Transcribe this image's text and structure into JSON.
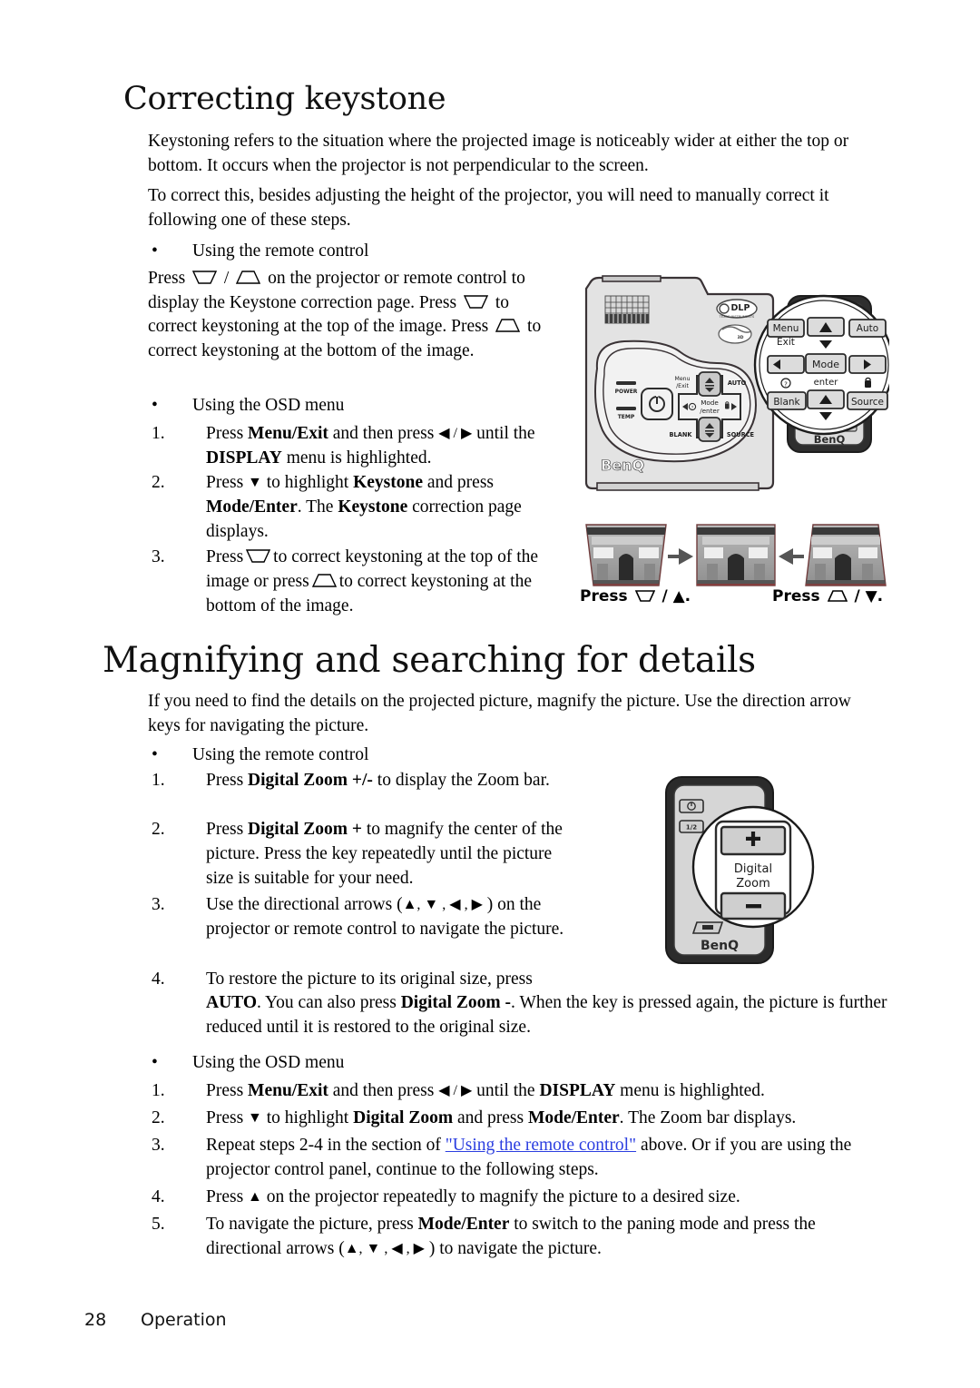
{
  "document": {
    "page_number": "28",
    "footer_section": "Operation"
  },
  "section1": {
    "heading": "Correcting keystone",
    "intro1": "Keystoning refers to the situation where the projected image is noticeably wider at either the top or bottom. It occurs when the projector is not perpendicular to the screen.",
    "intro2": "To correct this, besides adjusting the height of the projector, you will need to manually correct it following one of these steps.",
    "bullet_remote": "Using the remote control",
    "remote_para_a": "Press",
    "remote_para_b": "/",
    "remote_para_c": "on the projector or remote control to display the Keystone correction page. Press",
    "remote_para_d": "to correct keystoning at the top of the image. Press",
    "remote_para_e": "to correct keystoning at the bottom of the image.",
    "bullet_osd": "Using the OSD menu",
    "osd_items": [
      {
        "num": "1.",
        "a": "Press ",
        "bold1": "Menu/Exit",
        "b": " and then press ",
        "arrows": "◀ / ▶",
        "c": " until the ",
        "bold2": "DISPLAY",
        "d": " menu is highlighted."
      },
      {
        "num": "2.",
        "a": "Press ",
        "arrows": "▼",
        "b": " to highlight ",
        "bold1": "Keystone",
        "c": " and press ",
        "bold2": "Mode/Enter",
        "d": ". The ",
        "bold3": "Keystone",
        "e": " correction page displays."
      },
      {
        "num": "3.",
        "a": "Press",
        "b": "to correct keystoning at the top of the image or press",
        "c": "to correct keystoning at the bottom of the image."
      }
    ]
  },
  "section2": {
    "heading": "Magnifying and searching for details",
    "intro": "If you need to find the details on the projected picture, magnify the picture. Use the direction arrow keys for navigating the picture.",
    "bullet_remote": "Using the remote control",
    "remote_items": [
      {
        "num": "1.",
        "a": "Press ",
        "bold1": "Digital Zoom +/-",
        "b": " to display the Zoom bar."
      },
      {
        "num": "2.",
        "a": "Press ",
        "bold1": "Digital Zoom +",
        "b": " to magnify the center of the picture. Press the key repeatedly until the picture size is suitable for your need."
      },
      {
        "num": "3.",
        "a": "Use the directional arrows (",
        "arrows": "▲, ▼ , ◀ , ▶",
        "b": " ) on the projector or remote control to navigate the picture."
      },
      {
        "num": "4.",
        "a": "To restore the picture to its original size, press ",
        "bold1": "AUTO",
        "b": ". You can also press ",
        "bold2": "Digital Zoom -",
        "c": ". When the key is pressed again, the picture is further reduced until it is restored to the original size."
      }
    ],
    "bullet_osd": "Using the OSD menu",
    "osd_items": [
      {
        "num": "1.",
        "a": "Press ",
        "bold1": "Menu/Exit",
        "b": " and then press ",
        "arrows": "◀ / ▶",
        "c": " until the ",
        "bold2": "DISPLAY",
        "d": " menu is highlighted."
      },
      {
        "num": "2.",
        "a": "Press ",
        "arrows": "▼",
        "b": " to highlight ",
        "bold1": "Digital Zoom",
        "c": " and press ",
        "bold2": "Mode/Enter",
        "d": ". The Zoom bar displays."
      },
      {
        "num": "3.",
        "a": "Repeat steps 2-4 in the section of ",
        "link": "\"Using the remote control\"",
        "b": " above. Or if you are using the projector control panel, continue to the following steps."
      },
      {
        "num": "4.",
        "a": "Press ",
        "arrows": "▲",
        "b": " on the projector repeatedly to magnify the picture to a desired size."
      },
      {
        "num": "5.",
        "a": "To navigate the picture, press ",
        "bold1": "Mode/Enter",
        "b": " to switch to the paning mode and press the directional arrows (",
        "arrows": "▲, ▼ , ◀ , ▶",
        "c": " ) to navigate the picture."
      }
    ]
  },
  "illustration_projector": {
    "brand": "BenQ",
    "dlp_badge": "DLP",
    "dlp_sub": "TEXAS INSTRUMENTS",
    "badge2": "3D",
    "led_power": "POWER",
    "led_temp": "TEMP",
    "panel_menu": "Menu /Exit",
    "panel_menu_l1": "Menu",
    "panel_menu_l2": "/Exit",
    "panel_auto": "AUTO",
    "panel_mode_l1": "Mode",
    "panel_mode_l2": "/enter",
    "panel_blank": "BLANK",
    "panel_source": "SOURCE",
    "remote_menu": "Menu",
    "remote_exit": "Exit",
    "remote_auto": "Auto",
    "remote_mode": "Mode",
    "remote_enter": "enter",
    "remote_blank": "Blank",
    "remote_source": "Source",
    "up_arrow": "▲",
    "down_arrow": "▼",
    "left_arrow": "◀",
    "right_arrow": "▶",
    "lock_icon": "🔒",
    "help_icon": "?"
  },
  "illustration_keystone": {
    "caption_left_press": "Press",
    "caption_left_arrow": "/ ▲.",
    "caption_right_press": "Press",
    "caption_right_arrow": "/ ▼.",
    "image_alt": "Arc de Triomphe projected image"
  },
  "illustration_remote": {
    "brand": "BenQ",
    "label_line1": "Digital",
    "label_line2": "Zoom",
    "plus": "+",
    "minus": "−",
    "power_icon": "⏻",
    "source_icon": "1/2"
  }
}
